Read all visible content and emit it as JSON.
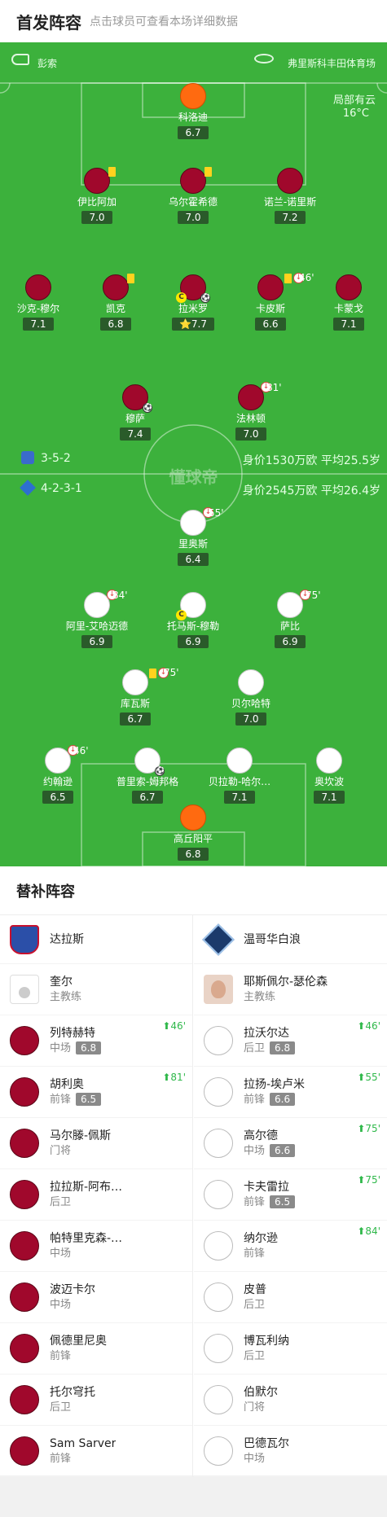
{
  "header": {
    "title": "首发阵容",
    "subtitle": "点击球员可查看本场详细数据"
  },
  "match_info": {
    "referee": "彭索",
    "venue": "弗里斯科丰田体育场",
    "weather": "局部有云",
    "temperature": "16°C",
    "watermark": "懂球帝"
  },
  "home_team": {
    "name": "达拉斯",
    "formation": "3-5-2",
    "value_text": "身价1530万欧 平均25.5岁",
    "coach": "奎尔",
    "coach_label": "主教练"
  },
  "away_team": {
    "name": "温哥华白浪",
    "formation": "4-2-3-1",
    "value_text": "身价2545万欧 平均26.4岁",
    "coach": "耶斯佩尔-瑟伦森",
    "coach_label": "主教练"
  },
  "home_players": [
    {
      "name": "科洛迪",
      "rating": "6.7"
    },
    {
      "name": "伊比阿加",
      "rating": "7.0"
    },
    {
      "name": "乌尔霍希德",
      "rating": "7.0"
    },
    {
      "name": "诺兰-诺里斯",
      "rating": "7.2"
    },
    {
      "name": "沙克-穆尔",
      "rating": "7.1"
    },
    {
      "name": "凯克",
      "rating": "6.8"
    },
    {
      "name": "拉米罗",
      "rating": "7.7",
      "star": "⭐"
    },
    {
      "name": "卡皮斯",
      "rating": "6.6",
      "sub_minute": "46'"
    },
    {
      "name": "卡蒙戈",
      "rating": "7.1"
    },
    {
      "name": "穆萨",
      "rating": "7.4"
    },
    {
      "name": "法林顿",
      "rating": "7.0",
      "sub_minute": "81'"
    }
  ],
  "away_players": [
    {
      "name": "里奥斯",
      "rating": "6.4",
      "sub_minute": "55'"
    },
    {
      "name": "阿里-艾哈迈德",
      "rating": "6.9",
      "sub_minute": "84'"
    },
    {
      "name": "托马斯-穆勒",
      "rating": "6.9"
    },
    {
      "name": "萨比",
      "rating": "6.9",
      "sub_minute": "75'"
    },
    {
      "name": "库瓦斯",
      "rating": "6.7",
      "sub_minute": "75'"
    },
    {
      "name": "贝尔哈特",
      "rating": "7.0"
    },
    {
      "name": "约翰逊",
      "rating": "6.5",
      "sub_minute": "46'"
    },
    {
      "name": "普里索-姆邦格",
      "rating": "6.7"
    },
    {
      "name": "贝拉勒-哈尔…",
      "rating": "7.1"
    },
    {
      "name": "奥坎波",
      "rating": "7.1"
    },
    {
      "name": "高丘阳平",
      "rating": "6.8"
    }
  ],
  "bench": {
    "title": "替补阵容",
    "home": [
      {
        "name": "列特赫特",
        "pos": "中场",
        "rating": "6.8",
        "sub_in": "46'"
      },
      {
        "name": "胡利奥",
        "pos": "前锋",
        "rating": "6.5",
        "sub_in": "81'"
      },
      {
        "name": "马尔滕-佩斯",
        "pos": "门将"
      },
      {
        "name": "拉拉斯-阿布…",
        "pos": "后卫"
      },
      {
        "name": "帕特里克森-…",
        "pos": "中场"
      },
      {
        "name": "波迈卡尔",
        "pos": "中场"
      },
      {
        "name": "佩德里尼奥",
        "pos": "前锋"
      },
      {
        "name": "托尔穹托",
        "pos": "后卫"
      },
      {
        "name": "Sam Sarver",
        "pos": "前锋"
      }
    ],
    "away": [
      {
        "name": "拉沃尔达",
        "pos": "后卫",
        "rating": "6.8",
        "sub_in": "46'"
      },
      {
        "name": "拉扬-埃卢米",
        "pos": "前锋",
        "rating": "6.6",
        "sub_in": "55'"
      },
      {
        "name": "高尔德",
        "pos": "中场",
        "rating": "6.6",
        "sub_in": "75'"
      },
      {
        "name": "卡夫雷拉",
        "pos": "前锋",
        "rating": "6.5",
        "sub_in": "75'"
      },
      {
        "name": "纳尔逊",
        "pos": "前锋",
        "sub_in": "84'"
      },
      {
        "name": "皮普",
        "pos": "后卫"
      },
      {
        "name": "博瓦利纳",
        "pos": "后卫"
      },
      {
        "name": "伯默尔",
        "pos": "门将"
      },
      {
        "name": "巴德瓦尔",
        "pos": "中场"
      }
    ]
  },
  "colors": {
    "pitch": "#3cb13c",
    "home_kit": "#a0082c",
    "away_kit": "#ffffff",
    "goalkeeper": "#ff6a10"
  }
}
